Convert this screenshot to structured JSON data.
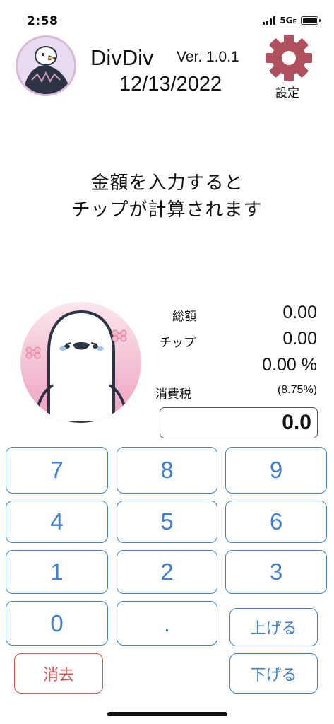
{
  "status_bar": {
    "time": "2:58",
    "network": "5G",
    "network_suffix": "E"
  },
  "header": {
    "app_name": "DivDiv",
    "version": "Ver. 1.0.1",
    "date": "12/13/2022",
    "settings_label": "設定"
  },
  "instruction": {
    "line1": "金額を入力すると",
    "line2": "チップが計算されます"
  },
  "totals": {
    "total_label": "総額",
    "total_value": "0.00",
    "tip_label": "チップ",
    "tip_value": "0.00",
    "tip_percent": "0.00 %",
    "tax_label": "消費税",
    "tax_rate": "(8.75%)"
  },
  "amount_input": {
    "value": "0.0"
  },
  "keypad": {
    "k7": "7",
    "k8": "8",
    "k9": "9",
    "k4": "4",
    "k5": "5",
    "k6": "6",
    "k1": "1",
    "k2": "2",
    "k3": "3",
    "k0": "0",
    "dot": ".",
    "raise": "上げる",
    "lower": "下げる",
    "clear": "消去"
  },
  "colors": {
    "key_blue": "#3f7fd1",
    "clear_red": "#d9534f",
    "gear": "#b0505e"
  }
}
